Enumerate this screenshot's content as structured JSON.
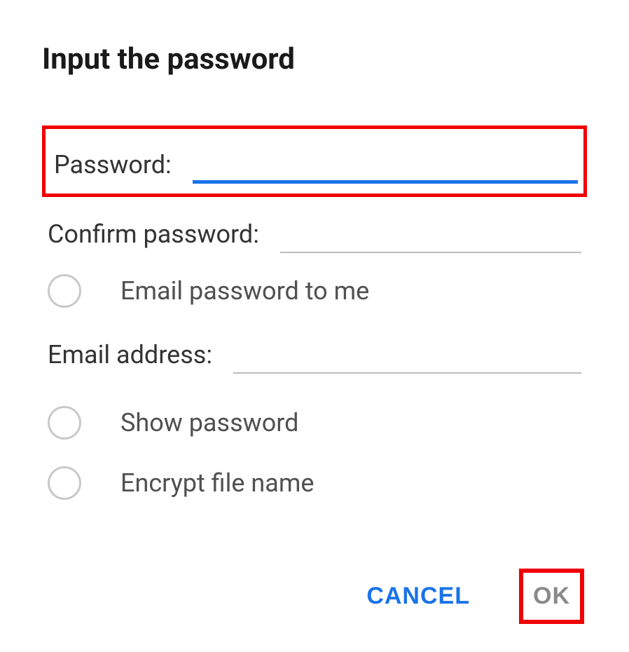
{
  "dialog": {
    "title": "Input the password",
    "password_label": "Password:",
    "confirm_label": "Confirm password:",
    "email_option_label": "Email password to me",
    "email_address_label": "Email address:",
    "show_password_label": "Show password",
    "encrypt_filename_label": "Encrypt file name",
    "password_value": "",
    "confirm_value": "",
    "email_address_value": ""
  },
  "actions": {
    "cancel": "CANCEL",
    "ok": "OK"
  }
}
